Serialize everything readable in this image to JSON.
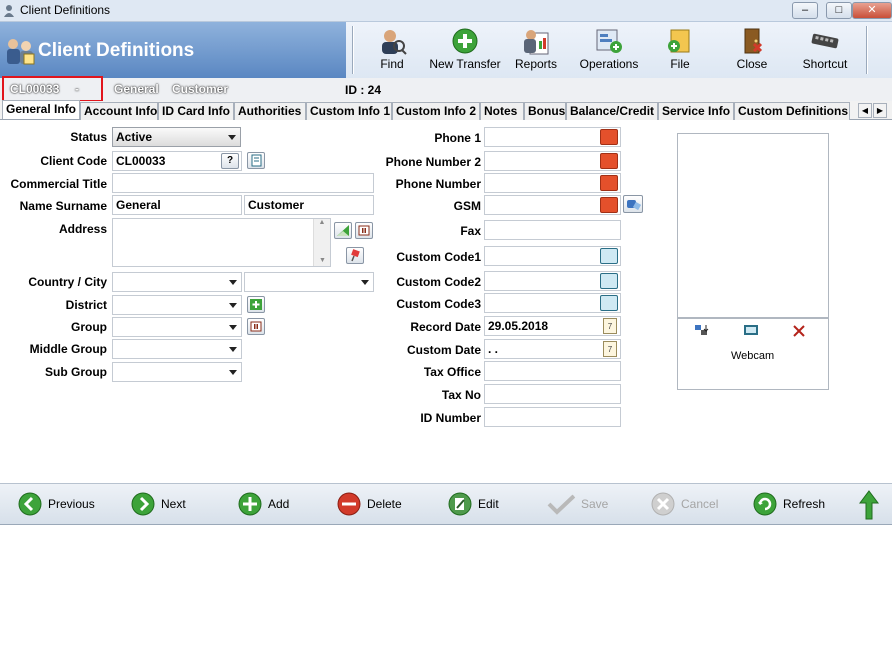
{
  "window": {
    "title": "Client Definitions",
    "min": "–",
    "max": "□",
    "close": "✕"
  },
  "header": {
    "title": "Client Definitions"
  },
  "toolbar": [
    {
      "label": "Find",
      "icon": "find-person-icon"
    },
    {
      "label": "New Transfer",
      "icon": "plus-circle-icon"
    },
    {
      "label": "Reports",
      "icon": "report-icon"
    },
    {
      "label": "Operations",
      "icon": "operations-icon"
    },
    {
      "label": "File",
      "icon": "file-icon"
    },
    {
      "label": "Close",
      "icon": "close-door-icon"
    },
    {
      "label": "Shortcut",
      "icon": "keyboard-icon"
    }
  ],
  "info": {
    "code": "CL00033",
    "dash": "-",
    "name": "General",
    "surname": "Customer",
    "id_label": "ID : 24"
  },
  "tabs": [
    "General Info",
    "Account Info",
    "ID Card Info",
    "Authorities",
    "Custom Info 1",
    "Custom Info 2",
    "Notes",
    "Bonus",
    "Balance/Credit",
    "Service Info",
    "Custom Definitions"
  ],
  "tab_arrows": {
    "left": "◀",
    "right": "▶"
  },
  "form_left": {
    "status_label": "Status",
    "status_value": "Active",
    "client_code_label": "Client Code",
    "client_code_value": "CL00033",
    "client_code_help": "?",
    "commercial_title_label": "Commercial Title",
    "commercial_title_value": "",
    "name_surname_label": "Name Surname",
    "name_value": "General",
    "surname_value": "Customer",
    "address_label": "Address",
    "address_value": "",
    "country_city_label": "Country / City",
    "district_label": "District",
    "group_label": "Group",
    "middle_group_label": "Middle Group",
    "sub_group_label": "Sub Group"
  },
  "form_right": {
    "phone1_label": "Phone 1",
    "phone2_label": "Phone Number 2",
    "phone_number_label": "Phone Number",
    "gsm_label": "GSM",
    "fax_label": "Fax",
    "custom_code1_label": "Custom Code1",
    "custom_code2_label": "Custom Code2",
    "custom_code3_label": "Custom Code3",
    "record_date_label": "Record Date",
    "record_date_value": "29.05.2018",
    "custom_date_label": "Custom Date",
    "custom_date_value": ". .",
    "tax_office_label": "Tax Office",
    "tax_no_label": "Tax No",
    "id_number_label": "ID Number",
    "calendar_glyph": "7"
  },
  "photo": {
    "webcam_label": "Webcam"
  },
  "bottom_nav": [
    {
      "label": "Previous",
      "enabled": true
    },
    {
      "label": "Next",
      "enabled": true
    },
    {
      "label": "Add",
      "enabled": true
    },
    {
      "label": "Delete",
      "enabled": true
    },
    {
      "label": "Edit",
      "enabled": true
    },
    {
      "label": "Save",
      "enabled": false
    },
    {
      "label": "Cancel",
      "enabled": false
    },
    {
      "label": "Refresh",
      "enabled": true
    }
  ],
  "colors": {
    "header_blue": "#5a87c2",
    "highlight_red": "#e1151c",
    "green": "#3da33a",
    "red": "#d23a2a"
  }
}
